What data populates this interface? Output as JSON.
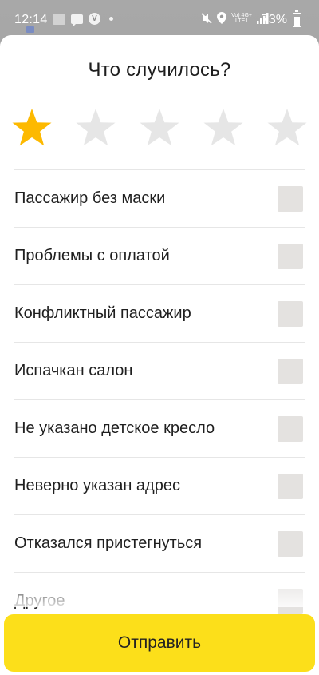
{
  "status_bar": {
    "time": "12:14",
    "network_label_top": "Vo) 4G+",
    "network_label_bottom": "LTE1",
    "battery": "73%"
  },
  "dialog": {
    "title": "Что случилось?",
    "rating": {
      "value": 1,
      "max": 5,
      "active_color": "#fdb900",
      "inactive_color": "#e6e6e6"
    },
    "options": [
      {
        "label": "Пассажир без маски",
        "checked": false
      },
      {
        "label": "Проблемы с оплатой",
        "checked": false
      },
      {
        "label": "Конфликтный пассажир",
        "checked": false
      },
      {
        "label": "Испачкан салон",
        "checked": false
      },
      {
        "label": "Не указано детское кресло",
        "checked": false
      },
      {
        "label": "Неверно указан адрес",
        "checked": false
      },
      {
        "label": "Отказался пристегнуться",
        "checked": false
      },
      {
        "label": "Другое",
        "checked": false
      }
    ],
    "submit_label": "Отправить",
    "submit_color": "#fcdf1a"
  }
}
